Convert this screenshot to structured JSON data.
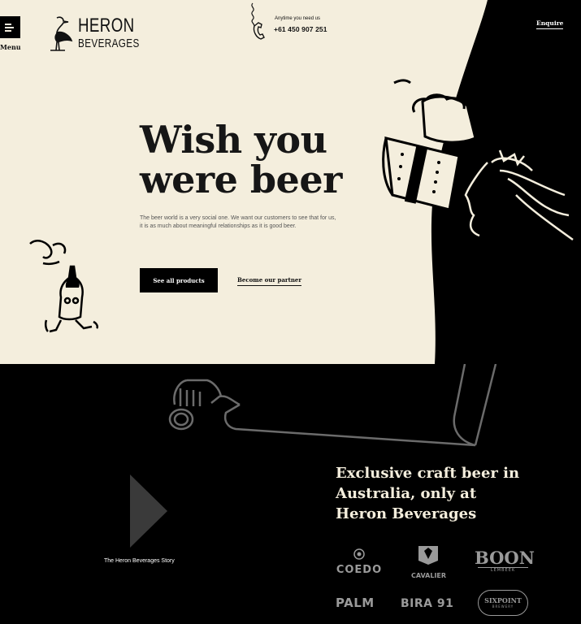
{
  "header": {
    "menu_label": "Menu",
    "logo_line1": "HERON",
    "logo_line2": "BEVERAGES",
    "contact_note": "Anytime you need us",
    "contact_phone": "+61 450 907 251",
    "enquire_label": "Enquire"
  },
  "hero": {
    "title_line1": "Wish you",
    "title_line2": "were beer",
    "intro": "The beer world is a very social one. We want our customers to see that for us, it is as much about meaningful relationships as it is good beer.",
    "primary_button": "See all products",
    "secondary_link": "Become our partner"
  },
  "bottom": {
    "story_label": "The Heron Beverages Story",
    "headline_line1": "Exclusive craft beer in",
    "headline_line2": "Australia, only at",
    "headline_line3": "Heron Beverages",
    "brands": [
      "COEDO",
      "CAVALIER",
      "BOON",
      "PALM",
      "BIRA 91",
      "SIXPOINT"
    ],
    "brand_sublabels": {
      "boon": "LEMBEEK",
      "sixpoint": "BREWERY"
    }
  },
  "colors": {
    "cream": "#f4eedd",
    "black": "#000000",
    "ink": "#161616",
    "logo_grey": "#9a9a9a"
  },
  "icons": [
    "hamburger-menu-icon",
    "heron-bird-icon",
    "phone-handset-icon",
    "play-icon"
  ]
}
